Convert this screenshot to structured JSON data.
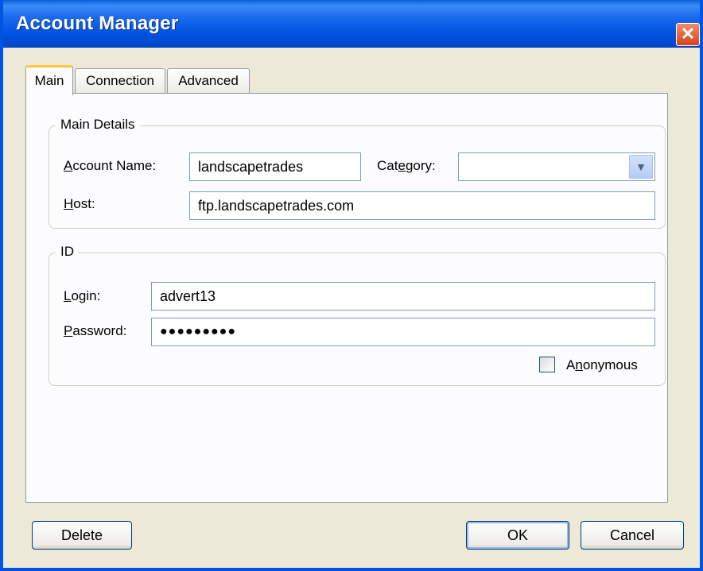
{
  "window": {
    "title": "Account Manager",
    "close_glyph": "✕"
  },
  "tabs": [
    {
      "label": "Main",
      "active": true
    },
    {
      "label": "Connection",
      "active": false
    },
    {
      "label": "Advanced",
      "active": false
    }
  ],
  "main_details": {
    "legend": "Main Details",
    "account_name_label_pre": "",
    "account_name_label_u": "A",
    "account_name_label_post": "ccount Name:",
    "account_name_value": "landscapetrades",
    "category_label_pre": "Cat",
    "category_label_u": "e",
    "category_label_post": "gory:",
    "category_value": "",
    "host_label_pre": "",
    "host_label_u": "H",
    "host_label_post": "ost:",
    "host_value": "ftp.landscapetrades.com"
  },
  "id_group": {
    "legend": "ID",
    "login_label_pre": "",
    "login_label_u": "L",
    "login_label_post": "ogin:",
    "login_value": "advert13",
    "password_label_pre": "",
    "password_label_u": "P",
    "password_label_post": "assword:",
    "password_value": "●●●●●●●●●",
    "anonymous_label_pre": "A",
    "anonymous_label_u": "n",
    "anonymous_label_post": "onymous",
    "anonymous_checked": false
  },
  "buttons": {
    "delete": "Delete",
    "ok": "OK",
    "cancel": "Cancel"
  },
  "colors": {
    "title_bar": "#0054e3",
    "close_button": "#e04b22",
    "tab_highlight": "#ffc83c"
  },
  "icons": {
    "close": "close-icon",
    "dropdown": "chevron-down-icon"
  }
}
